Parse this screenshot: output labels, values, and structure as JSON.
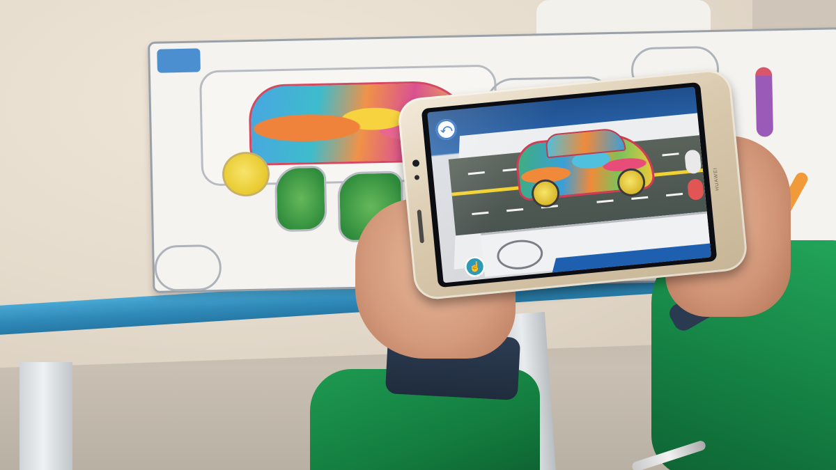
{
  "scene": {
    "description_label": "",
    "phone": {
      "brand_text": "HUAWEI",
      "screen": {
        "back_icon": "back-arrow-icon",
        "hand_icon": "hand-pointer-icon"
      }
    }
  },
  "colors": {
    "desk_edge": "#2f89b8",
    "jacket": "#158244",
    "road": "#4a5450",
    "road_line": "#f2d230",
    "ui_blue": "#2f73c8"
  }
}
